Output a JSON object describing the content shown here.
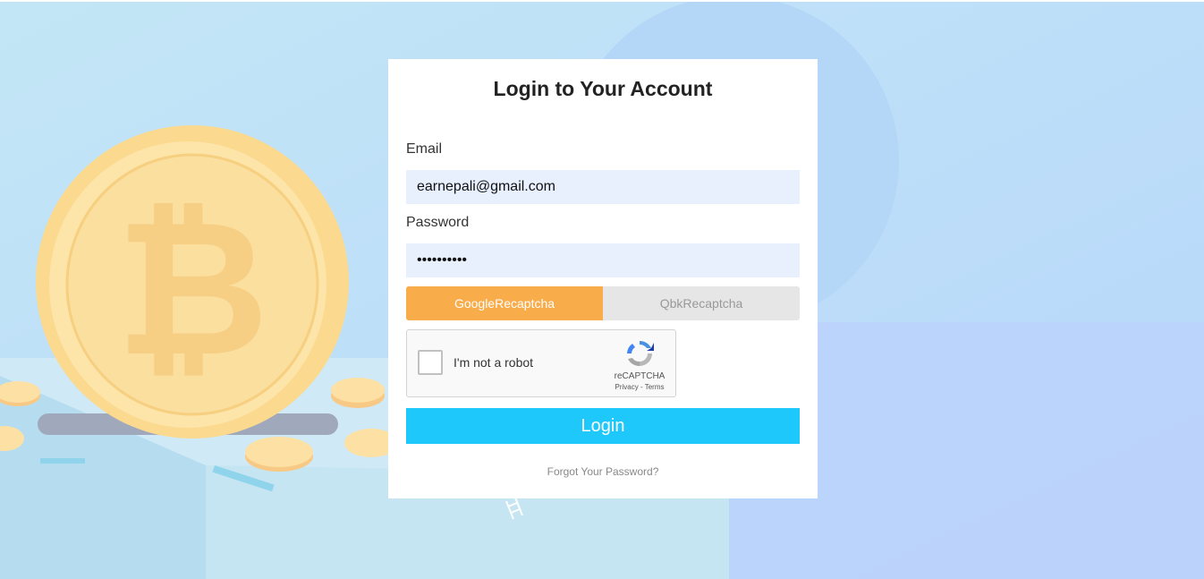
{
  "login": {
    "title": "Login to Your Account",
    "email_label": "Email",
    "email_value": "earnepali@gmail.com",
    "password_label": "Password",
    "password_value": "••••••••••",
    "tabs": [
      {
        "label": "GoogleRecaptcha",
        "active": true
      },
      {
        "label": "QbkRecaptcha",
        "active": false
      }
    ],
    "recaptcha": {
      "checkbox_label": "I'm not a robot",
      "brand": "reCAPTCHA",
      "privacy": "Privacy",
      "separator": " - ",
      "terms": "Terms"
    },
    "login_button": "Login",
    "forgot_link": "Forgot Your Password?"
  },
  "colors": {
    "accent_blue": "#1ec8fb",
    "tab_orange": "#f9ac4a",
    "field_bg": "#e8f0fe"
  }
}
